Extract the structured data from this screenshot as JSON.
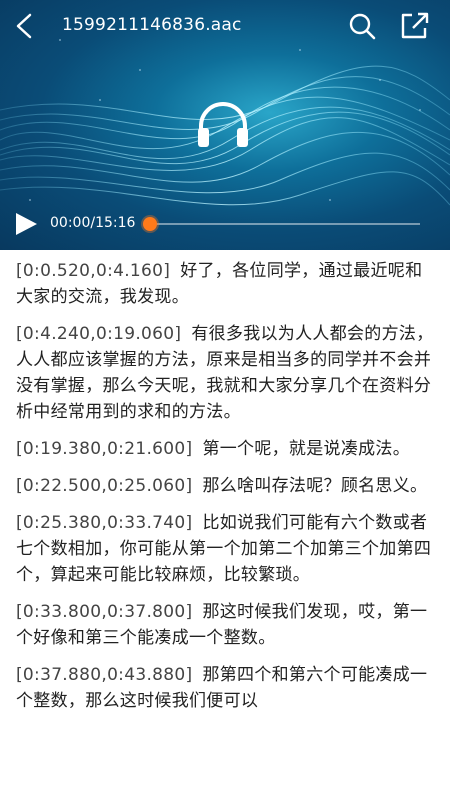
{
  "header": {
    "title": "1599211146836.aac",
    "icons": [
      "back-icon",
      "search-icon",
      "share-icon"
    ]
  },
  "player": {
    "center_icon": "headphones-icon",
    "play_icon": "play-icon",
    "time_text": "00:00/15:16",
    "progress_fraction": 0,
    "accent_color": "#ff7a1a"
  },
  "transcript": [
    {
      "ts": "[0:0.520,0:4.160]",
      "text": "好了，各位同学，通过最近呢和大家的交流，我发现。"
    },
    {
      "ts": "[0:4.240,0:19.060]",
      "text": "有很多我以为人人都会的方法，人人都应该掌握的方法，原来是相当多的同学并不会并没有掌握，那么今天呢，我就和大家分享几个在资料分析中经常用到的求和的方法。"
    },
    {
      "ts": "[0:19.380,0:21.600]",
      "text": "第一个呢，就是说凑成法。"
    },
    {
      "ts": "[0:22.500,0:25.060]",
      "text": "那么啥叫存法呢？顾名思义。"
    },
    {
      "ts": "[0:25.380,0:33.740]",
      "text": "比如说我们可能有六个数或者七个数相加，你可能从第一个加第二个加第三个加第四个，算起来可能比较麻烦，比较繁琐。"
    },
    {
      "ts": "[0:33.800,0:37.800]",
      "text": "那这时候我们发现，哎，第一个好像和第三个能凑成一个整数。"
    },
    {
      "ts": "[0:37.880,0:43.880]",
      "text": "那第四个和第六个可能凑成一个整数，那么这时候我们便可以"
    }
  ]
}
